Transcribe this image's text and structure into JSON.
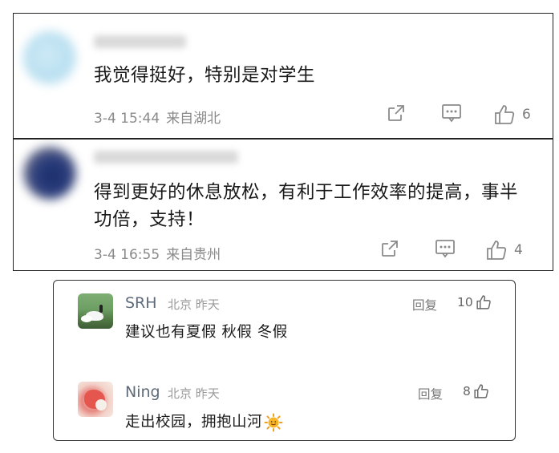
{
  "comments": [
    {
      "text": "我觉得挺好，特别是对学生",
      "date": "3-4 15:44",
      "region": "来自湖北",
      "likes": "6"
    },
    {
      "text": "得到更好的休息放松，有利于工作效率的提高，事半功倍，支持！",
      "date": "3-4 16:55",
      "region": "来自贵州",
      "likes": "4"
    }
  ],
  "replies": [
    {
      "name": "SRH",
      "location": "北京 昨天",
      "text": "建议也有夏假 秋假 冬假",
      "reply_label": "回复",
      "likes": "10"
    },
    {
      "name": "Ning",
      "location": "北京 昨天",
      "text": "走出校园，拥抱山河",
      "reply_label": "回复",
      "likes": "8"
    }
  ],
  "icons": {
    "share": "share-icon",
    "comment": "comment-icon",
    "like": "thumbs-up-icon",
    "emoji": "sun-emoji-icon"
  },
  "colors": {
    "meta_gray": "#8a8a8a",
    "name_blue_gray": "#5f6b7a",
    "emoji_orange": "#f0a020"
  }
}
